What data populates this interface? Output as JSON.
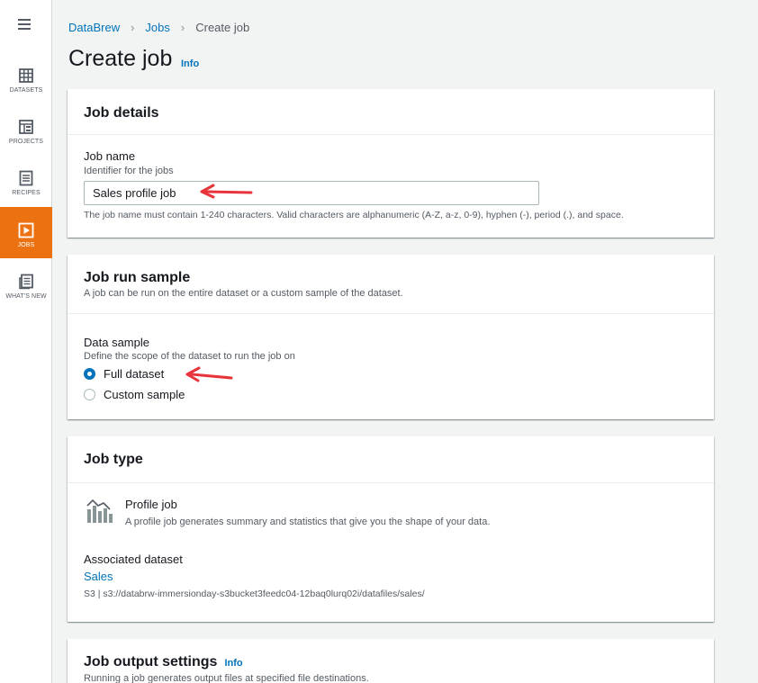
{
  "sidebar": {
    "items": [
      {
        "label": "DATASETS"
      },
      {
        "label": "PROJECTS"
      },
      {
        "label": "RECIPES"
      },
      {
        "label": "JOBS"
      },
      {
        "label": "WHAT'S NEW"
      }
    ],
    "active_item": "JOBS",
    "active_color": "#ec7211"
  },
  "breadcrumb": {
    "items": [
      "DataBrew",
      "Jobs",
      "Create job"
    ]
  },
  "page": {
    "title": "Create job",
    "info": "Info"
  },
  "job_details": {
    "title": "Job details",
    "job_name_label": "Job name",
    "job_name_desc": "Identifier for the jobs",
    "job_name_value": "Sales profile job",
    "constraint": "The job name must contain 1-240 characters. Valid characters are alphanumeric (A-Z, a-z, 0-9), hyphen (-), period (.), and space."
  },
  "job_run_sample": {
    "title": "Job run sample",
    "desc": "A job can be run on the entire dataset or a custom sample of the dataset.",
    "data_sample_label": "Data sample",
    "data_sample_desc": "Define the scope of the dataset to run the job on",
    "options": [
      {
        "label": "Full dataset",
        "checked": true
      },
      {
        "label": "Custom sample",
        "checked": false
      }
    ]
  },
  "job_type": {
    "title": "Job type",
    "type_title": "Profile job",
    "type_desc": "A profile job generates summary and statistics that give you the shape of your data.",
    "associated_label": "Associated dataset",
    "dataset_link": "Sales",
    "dataset_path": "S3 | s3://databrw-immersionday-s3bucket3feedc04-12baq0lurq02i/datafiles/sales/"
  },
  "job_output": {
    "title": "Job output settings",
    "info": "Info",
    "desc": "Running a job generates output files at specified file destinations."
  },
  "colors": {
    "link": "#0073bb",
    "annotation_arrow": "#e8333a"
  }
}
